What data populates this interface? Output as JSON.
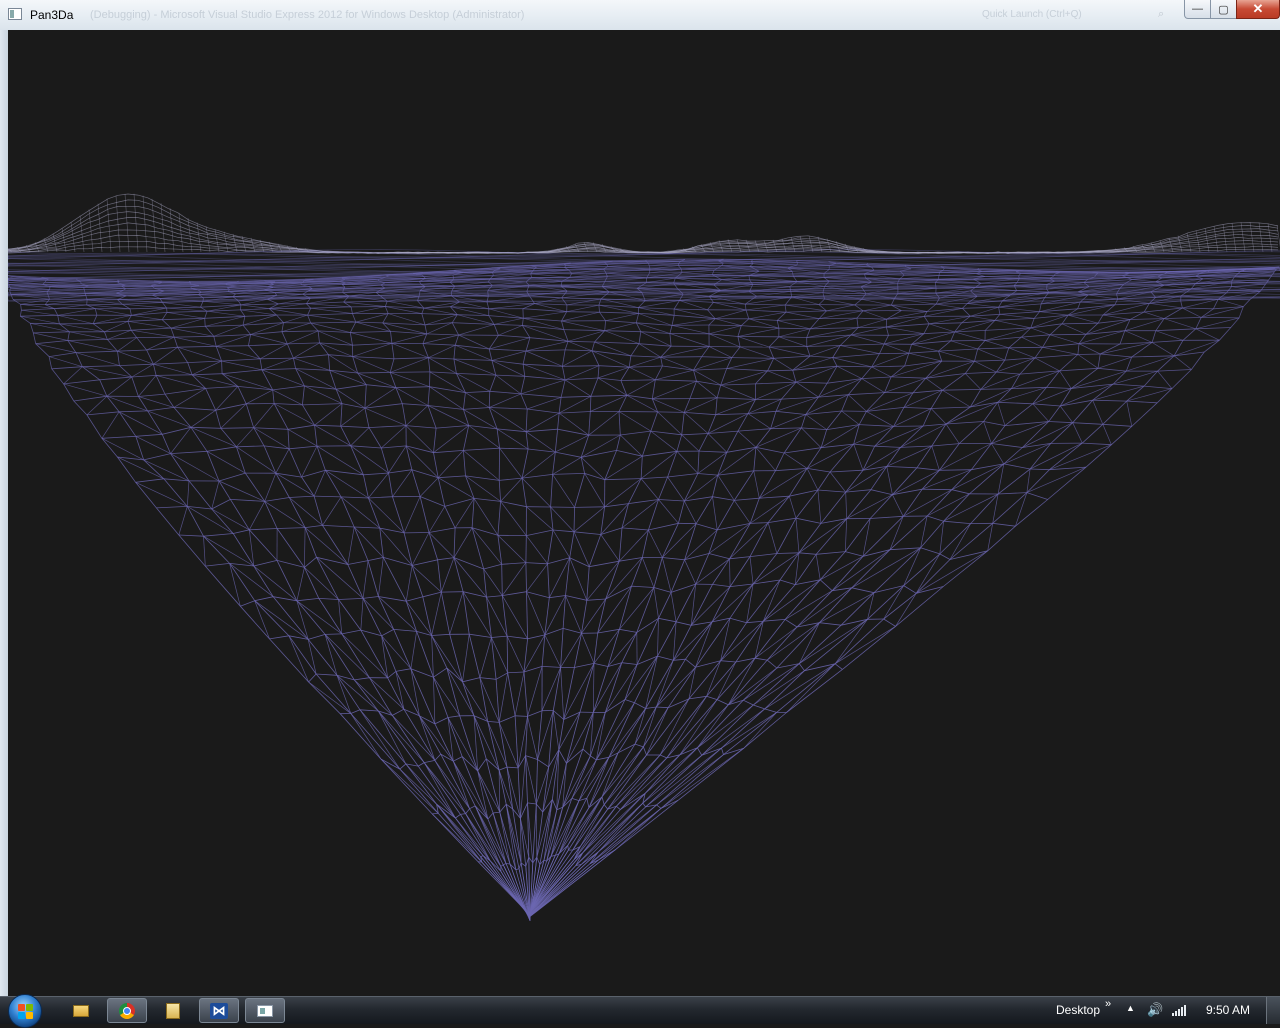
{
  "window": {
    "title": "Pan3Da",
    "ghost_title": "(Debugging) - Microsoft Visual Studio Express 2012 for Windows Desktop (Administrator)",
    "ghost_quick_launch": "Quick Launch (Ctrl+Q)",
    "close_glyph": "✕",
    "max_glyph": "▢",
    "min_glyph": "—"
  },
  "viewport": {
    "background": "#1a1a1a",
    "mesh_color": "#6b66b0",
    "mountain_color": "#a9a7c4"
  },
  "taskbar": {
    "desktop_label": "Desktop",
    "chevron": "»",
    "tray_arrow": "▲",
    "volume_glyph": "🔊",
    "clock": "9:50 AM",
    "vs_glyph": "⋈",
    "items": [
      {
        "name": "windows-explorer",
        "active": false
      },
      {
        "name": "google-chrome",
        "active": true
      },
      {
        "name": "file-manager",
        "active": false
      },
      {
        "name": "visual-studio",
        "active": true
      },
      {
        "name": "pan3da",
        "active": true
      }
    ]
  }
}
